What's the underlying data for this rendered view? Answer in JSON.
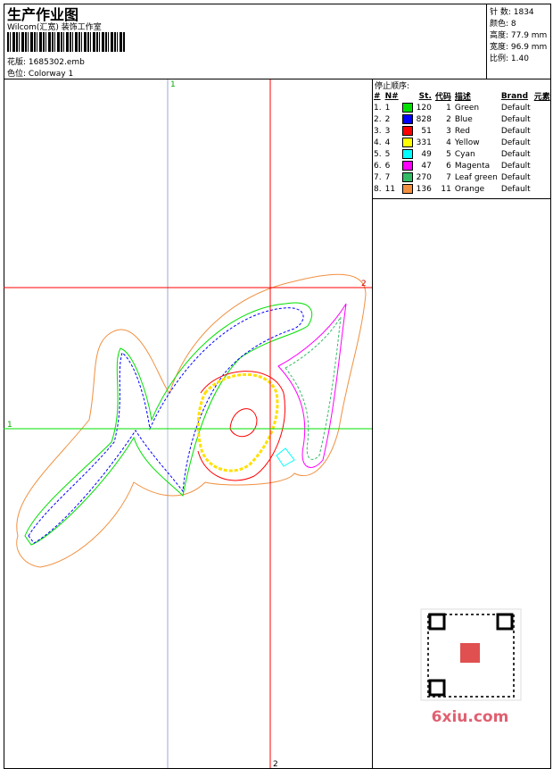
{
  "header": {
    "title": "生产作业图",
    "company": "Wilcom(汇宽) 装饰工作室",
    "design_label": "花版:",
    "design_file": "1685302.emb",
    "colorway_label": "色位:",
    "colorway": "Colorway 1"
  },
  "info": {
    "stitches": "针 数: 1834",
    "colors": "颜色: 8",
    "height": "高度: 77.9 mm",
    "width": "宽度: 96.9 mm",
    "scale": "比例: 1.40"
  },
  "stop_sequence": {
    "title": "停止顺序:",
    "columns": [
      "#",
      "N#",
      "St.",
      "代码",
      "描述",
      "Brand",
      "元素"
    ],
    "rows": [
      {
        "idx": "1.",
        "n": "1",
        "color": "#00e000",
        "st": "120",
        "code": "1",
        "desc": "Green",
        "brand": "Default"
      },
      {
        "idx": "2.",
        "n": "2",
        "color": "#0000ff",
        "st": "828",
        "code": "2",
        "desc": "Blue",
        "brand": "Default"
      },
      {
        "idx": "3.",
        "n": "3",
        "color": "#ff0000",
        "st": "51",
        "code": "3",
        "desc": "Red",
        "brand": "Default"
      },
      {
        "idx": "4.",
        "n": "4",
        "color": "#ffff00",
        "st": "331",
        "code": "4",
        "desc": "Yellow",
        "brand": "Default"
      },
      {
        "idx": "5.",
        "n": "5",
        "color": "#00ffff",
        "st": "49",
        "code": "5",
        "desc": "Cyan",
        "brand": "Default"
      },
      {
        "idx": "6.",
        "n": "6",
        "color": "#ff00ff",
        "st": "47",
        "code": "6",
        "desc": "Magenta",
        "brand": "Default"
      },
      {
        "idx": "7.",
        "n": "7",
        "color": "#33bb66",
        "st": "270",
        "code": "7",
        "desc": "Leaf green",
        "brand": "Default"
      },
      {
        "idx": "8.",
        "n": "11",
        "color": "#f09040",
        "st": "136",
        "code": "11",
        "desc": "Orange",
        "brand": "Default"
      }
    ]
  },
  "canvas": {
    "marker_1": "1",
    "marker_2": "2"
  },
  "watermark": "6xiu.com"
}
